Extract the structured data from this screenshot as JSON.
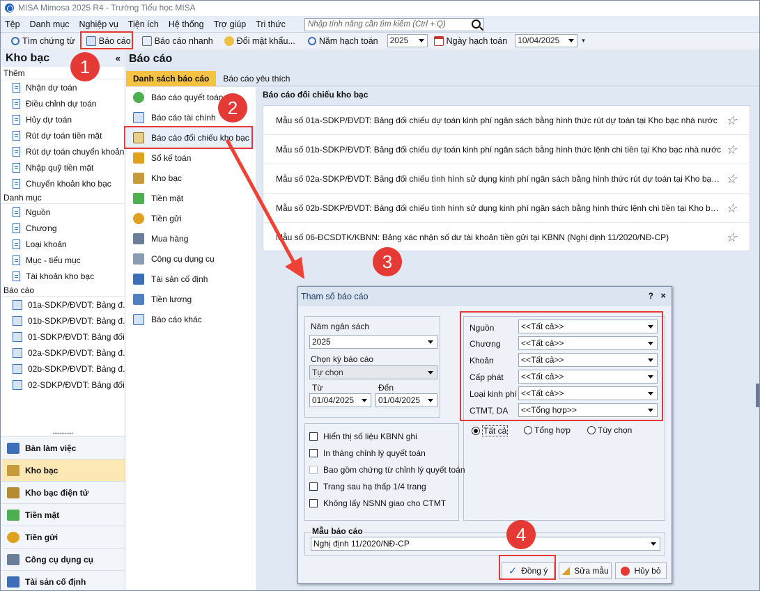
{
  "app": {
    "title": "MISA Mimosa 2025 R4 - Trường Tiểu học MISA"
  },
  "menu": [
    "Tệp",
    "Danh mục",
    "Nghiệp vụ",
    "Tiện ích",
    "Hệ thống",
    "Trợ giúp",
    "Tri thức"
  ],
  "search": {
    "placeholder": "Nhập tính năng cần tìm kiếm (Ctrl + Q)"
  },
  "toolbar": {
    "find": "Tìm chứng từ",
    "report": "Báo cáo",
    "quick_report": "Báo cáo nhanh",
    "change_password": "Đổi mật khẩu...",
    "fiscal_year_label": "Năm hạch toán",
    "fiscal_year_value": "2025",
    "posting_date_label": "Ngày hạch toán",
    "posting_date_value": "10/04/2025"
  },
  "sidebar": {
    "title": "Kho bạc",
    "collapse": "«",
    "sections": {
      "add": "Thêm",
      "catalog": "Danh mục",
      "reports": "Báo cáo"
    },
    "add_items": [
      "Nhận dự toán",
      "Điều chỉnh dự toán",
      "Hủy dự toán",
      "Rút dự toán tiền mặt",
      "Rút dự toán chuyển khoản",
      "Nhập quỹ tiền mặt",
      "Chuyển khoản kho bạc"
    ],
    "catalog_items": [
      "Nguồn",
      "Chương",
      "Loại khoản",
      "Mục - tiểu mục",
      "Tài khoản kho bạc"
    ],
    "report_items": [
      "01a-SDKP/ĐVDT: Bảng đ...",
      "01b-SDKP/ĐVDT: Bảng đ...",
      "01-SDKP/ĐVDT: Bảng đối...",
      "02a-SDKP/ĐVDT: Bảng đ...",
      "02b-SDKP/ĐVDT: Bảng đ...",
      "02-SDKP/ĐVDT: Bảng đối..."
    ],
    "nav": [
      "Bàn làm việc",
      "Kho bạc",
      "Kho bạc điện tử",
      "Tiền mặt",
      "Tiền gửi",
      "Công cụ dụng cụ",
      "Tài sản cố định"
    ]
  },
  "main": {
    "title": "Báo cáo",
    "tabs": [
      "Danh sách báo cáo",
      "Báo cáo yêu thích"
    ],
    "categories": [
      "Báo cáo quyết toán",
      "Báo cáo tài chính",
      "Báo cáo đối chiếu kho bạc",
      "Sổ kế toán",
      "Kho bạc",
      "Tiền mặt",
      "Tiền gửi",
      "Mua hàng",
      "Công cụ dụng cụ",
      "Tài sản cố định",
      "Tiền lương",
      "Báo cáo khác"
    ],
    "report_heading": "Báo cáo đối chiếu kho bạc",
    "reports": [
      "Mẫu số 01a-SDKP/ĐVDT: Bảng đối chiếu dự toán kinh phí ngân sách bằng hình thức rút dự toán tại Kho bạc nhà nước",
      "Mẫu số 01b-SDKP/ĐVDT: Bảng đối chiếu dự toán kinh phí ngân sách bằng hình thức lệnh chi tiền tại Kho bạc nhà nước",
      "Mẫu số 02a-SDKP/ĐVDT: Bảng đối chiếu tình hình sử dụng kinh phí ngân sách bằng hình thức rút dự toán tại Kho bạc nhà nư...",
      "Mẫu số 02b-SDKP/ĐVDT: Bảng đối chiếu tình hình sử dụng kinh phí ngân sách bằng hình thức lệnh chi tiền tại Kho bạc nhà n...",
      "Mẫu số 06-ĐCSDTK/KBNN: Bảng xác nhận số dư tài khoản tiền gửi tại KBNN (Nghị định 11/2020/NĐ-CP)"
    ]
  },
  "dialog": {
    "title": "Tham số báo cáo",
    "help": "?",
    "close": "×",
    "budget_year_label": "Năm ngân sách",
    "budget_year_value": "2025",
    "period_label": "Chọn kỳ báo cáo",
    "period_value": "Tự chọn",
    "from_label": "Từ",
    "from_value": "01/04/2025",
    "to_label": "Đến",
    "to_value": "01/04/2025",
    "filters": [
      {
        "label": "Nguồn",
        "value": "<<Tất cả>>"
      },
      {
        "label": "Chương",
        "value": "<<Tất cả>>"
      },
      {
        "label": "Khoản",
        "value": "<<Tất cả>>"
      },
      {
        "label": "Cấp phát",
        "value": "<<Tất cả>>"
      },
      {
        "label": "Loại kinh phí",
        "value": "<<Tất cả>>"
      },
      {
        "label": "CTMT, DA",
        "value": "<<Tổng hợp>>"
      }
    ],
    "radios": [
      "Tất cả",
      "Tổng hợp",
      "Tùy chọn"
    ],
    "checks": [
      "Hiển thị số liệu KBNN ghi",
      "In tháng chỉnh lý quyết toán",
      "Bao gồm chứng từ chỉnh lý quyết toán",
      "Trang sau hạ thấp 1/4 trang",
      "Không lấy NSNN giao cho CTMT"
    ],
    "template_label": "Mẫu báo cáo",
    "template_value": "Nghị định 11/2020/NĐ-CP",
    "ok": "Đồng ý",
    "edit": "Sửa mẫu",
    "cancel": "Hủy bỏ"
  },
  "annotations": [
    "1",
    "2",
    "3",
    "4"
  ],
  "colors": {
    "accent": "#f5c242",
    "highlight": "#e53935",
    "panel": "#dfe8f3"
  }
}
